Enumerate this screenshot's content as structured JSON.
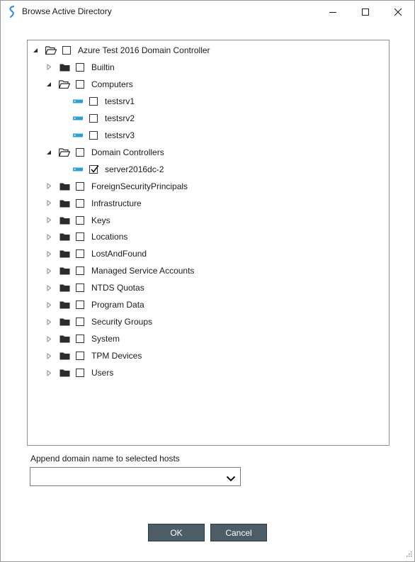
{
  "window": {
    "title": "Browse Active Directory",
    "controls": [
      "minimize-icon",
      "maximize-icon",
      "close-icon"
    ]
  },
  "tree": [
    {
      "label": "Azure Test 2016 Domain Controller",
      "level": 0,
      "expander": "expanded",
      "icon": "folder-open-icon",
      "checked": false
    },
    {
      "label": "Builtin",
      "level": 1,
      "expander": "collapsed",
      "icon": "folder-icon",
      "checked": false
    },
    {
      "label": "Computers",
      "level": 1,
      "expander": "expanded",
      "icon": "folder-open-icon",
      "checked": false
    },
    {
      "label": "testsrv1",
      "level": 2,
      "expander": "none",
      "icon": "server-icon",
      "checked": false
    },
    {
      "label": "testsrv2",
      "level": 2,
      "expander": "none",
      "icon": "server-icon",
      "checked": false
    },
    {
      "label": "testsrv3",
      "level": 2,
      "expander": "none",
      "icon": "server-icon",
      "checked": false
    },
    {
      "label": "Domain Controllers",
      "level": 1,
      "expander": "expanded",
      "icon": "folder-open-icon",
      "checked": false
    },
    {
      "label": "server2016dc-2",
      "level": 2,
      "expander": "none",
      "icon": "server-icon",
      "checked": true
    },
    {
      "label": "ForeignSecurityPrincipals",
      "level": 1,
      "expander": "collapsed",
      "icon": "folder-icon",
      "checked": false
    },
    {
      "label": "Infrastructure",
      "level": 1,
      "expander": "collapsed",
      "icon": "folder-icon",
      "checked": false
    },
    {
      "label": "Keys",
      "level": 1,
      "expander": "collapsed",
      "icon": "folder-icon",
      "checked": false
    },
    {
      "label": "Locations",
      "level": 1,
      "expander": "collapsed",
      "icon": "folder-icon",
      "checked": false
    },
    {
      "label": "LostAndFound",
      "level": 1,
      "expander": "collapsed",
      "icon": "folder-icon",
      "checked": false
    },
    {
      "label": "Managed Service Accounts",
      "level": 1,
      "expander": "collapsed",
      "icon": "folder-icon",
      "checked": false
    },
    {
      "label": "NTDS Quotas",
      "level": 1,
      "expander": "collapsed",
      "icon": "folder-icon",
      "checked": false
    },
    {
      "label": "Program Data",
      "level": 1,
      "expander": "collapsed",
      "icon": "folder-icon",
      "checked": false
    },
    {
      "label": "Security Groups",
      "level": 1,
      "expander": "collapsed",
      "icon": "folder-icon",
      "checked": false
    },
    {
      "label": "System",
      "level": 1,
      "expander": "collapsed",
      "icon": "folder-icon",
      "checked": false
    },
    {
      "label": "TPM Devices",
      "level": 1,
      "expander": "collapsed",
      "icon": "folder-icon",
      "checked": false
    },
    {
      "label": "Users",
      "level": 1,
      "expander": "collapsed",
      "icon": "folder-icon",
      "checked": false
    }
  ],
  "append_domain": {
    "label": "Append domain name to selected hosts",
    "value": ""
  },
  "buttons": {
    "ok": "OK",
    "cancel": "Cancel"
  },
  "colors": {
    "button_bg": "#4d5d67",
    "server_icon": "#2e9fd0",
    "app_icon": "#3a8fd8"
  }
}
